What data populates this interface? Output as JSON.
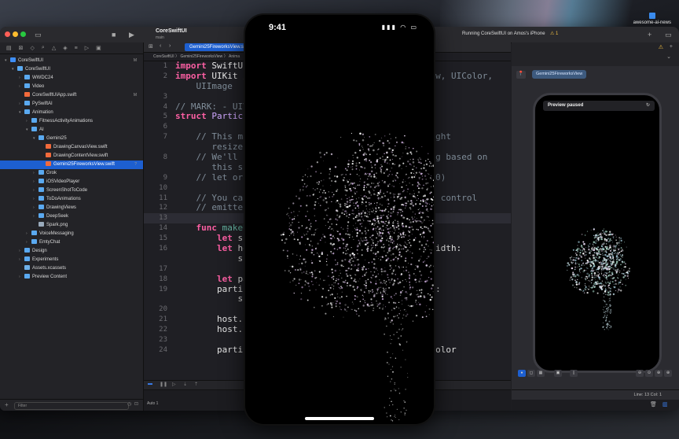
{
  "desktop": {
    "icon_label": "awesome-ai-news"
  },
  "titlebar": {
    "project_name": "CoreSwiftUI",
    "branch": "main",
    "run_status": "Running CoreSwiftUI on Amos's iPhone",
    "warning_count": "1"
  },
  "navigator": {
    "filter_placeholder": "Filter",
    "items": [
      {
        "label": "CoreSwiftUI",
        "depth": 0,
        "icon": "proj",
        "badge": "M",
        "chev": "▾"
      },
      {
        "label": "CoreSwiftUI",
        "depth": 1,
        "icon": "folder",
        "chev": "▾"
      },
      {
        "label": "WWDC24",
        "depth": 2,
        "icon": "folder",
        "chev": "›"
      },
      {
        "label": "Video",
        "depth": 2,
        "icon": "folder",
        "chev": "›"
      },
      {
        "label": "CoreSwiftUIApp.swift",
        "depth": 2,
        "icon": "swift",
        "badge": "M"
      },
      {
        "label": "PySwiftAI",
        "depth": 2,
        "icon": "folder",
        "chev": "›"
      },
      {
        "label": "Animation",
        "depth": 2,
        "icon": "folder",
        "chev": "▾"
      },
      {
        "label": "FitnessActivityAnimations",
        "depth": 3,
        "icon": "folder",
        "chev": "›"
      },
      {
        "label": "AI",
        "depth": 3,
        "icon": "folder",
        "chev": "▾"
      },
      {
        "label": "Gemini25",
        "depth": 4,
        "icon": "folder",
        "chev": "▾"
      },
      {
        "label": "DrawingCanvasView.swift",
        "depth": 5,
        "icon": "swift"
      },
      {
        "label": "DrawingContentView.swift",
        "depth": 5,
        "icon": "swift"
      },
      {
        "label": "Gemini25FireworksView.swift",
        "depth": 5,
        "icon": "swift",
        "selected": true,
        "badge": "?"
      },
      {
        "label": "Grok",
        "depth": 4,
        "icon": "folder",
        "chev": "›"
      },
      {
        "label": "iOSVideoPlayer",
        "depth": 4,
        "icon": "folder",
        "chev": "›"
      },
      {
        "label": "ScreenShotToCode",
        "depth": 4,
        "icon": "folder",
        "chev": "›"
      },
      {
        "label": "ToDoAnimations",
        "depth": 4,
        "icon": "folder",
        "chev": "›"
      },
      {
        "label": "DrawingViews",
        "depth": 4,
        "icon": "folder",
        "chev": "›"
      },
      {
        "label": "DeepSeek",
        "depth": 4,
        "icon": "folder",
        "chev": "›"
      },
      {
        "label": "Spark.png",
        "depth": 4,
        "icon": "img"
      },
      {
        "label": "VoiceMessaging",
        "depth": 3,
        "icon": "folder",
        "chev": "›"
      },
      {
        "label": "EmtyChat",
        "depth": 3,
        "icon": "folder",
        "chev": "›"
      },
      {
        "label": "Design",
        "depth": 2,
        "icon": "folder",
        "chev": "›"
      },
      {
        "label": "Experiments",
        "depth": 2,
        "icon": "folder",
        "chev": "›"
      },
      {
        "label": "Assets.xcassets",
        "depth": 2,
        "icon": "asset"
      },
      {
        "label": "Preview Content",
        "depth": 2,
        "icon": "folder",
        "chev": "›"
      }
    ]
  },
  "editor": {
    "tab_label": "Gemini25FireworksView.swift",
    "jump_bar": "CoreSwiftUI 〉 Gemini25FireworksView 〉 Anima",
    "auto_label": "Auto 1",
    "lines": [
      {
        "n": "1",
        "html": "<span class=\"kw\">import</span> SwiftUI"
      },
      {
        "n": "2",
        "html": "<span class=\"kw\">import</span> UIKit <span class=\"cm\">//                                  ew, UIColor,</span>"
      },
      {
        "n": "",
        "html": "<span class=\"cm\">    UIImage</span>"
      },
      {
        "n": "3",
        "html": ""
      },
      {
        "n": "4",
        "html": "<span class=\"cm\">// MARK: - UIVi</span>"
      },
      {
        "n": "5",
        "html": "<span class=\"kw\">struct</span> <span class=\"ty\">Particle</span>"
      },
      {
        "n": "6",
        "html": ""
      },
      {
        "n": "7",
        "html": "<span class=\"cm\">    // This mat                              UI might</span>"
      },
      {
        "n": "",
        "html": "<span class=\"cm\">       resize</span>"
      },
      {
        "n": "8",
        "html": "<span class=\"cm\">    // We'll us                              coding based on</span>"
      },
      {
        "n": "",
        "html": "<span class=\"cm\">       this si</span>"
      },
      {
        "n": "9",
        "html": "<span class=\"cm\">    // let orig                              1118.0)</span>"
      },
      {
        "n": "10",
        "html": ""
      },
      {
        "n": "11",
        "html": "<span class=\"cm\">    // You can                               nt to control</span>"
      },
      {
        "n": "12",
        "html": "<span class=\"cm\">    // emitter                               te.</span>"
      },
      {
        "n": "13",
        "html": "",
        "cur": true
      },
      {
        "n": "14",
        "html": "    <span class=\"kw\">func</span> <span class=\"pr\">makeUI</span>"
      },
      {
        "n": "15",
        "html": "        <span class=\"kw\">let</span> siz                                <span class=\"nm\">0</span>)"
      },
      {
        "n": "16",
        "html": "        <span class=\"kw\">let</span> hos                               <span class=\"nm\">0</span>, width:"
      },
      {
        "n": "",
        "html": "            si"
      },
      {
        "n": "17",
        "html": ""
      },
      {
        "n": "18",
        "html": "        <span class=\"kw\">let</span> par"
      },
      {
        "n": "19",
        "html": "        particl                              width:"
      },
      {
        "n": "",
        "html": "            si"
      },
      {
        "n": "20",
        "html": ""
      },
      {
        "n": "21",
        "html": "        host.la"
      },
      {
        "n": "22",
        "html": "        host.la"
      },
      {
        "n": "23",
        "html": ""
      },
      {
        "n": "24",
        "html": "        particl                              k.cgColor"
      }
    ]
  },
  "canvas": {
    "preview_chip": "Gemini25FireworksView",
    "preview_paused": "Preview paused",
    "cursor_position": "Line: 13  Col: 1"
  },
  "simulator": {
    "time": "9:41"
  }
}
